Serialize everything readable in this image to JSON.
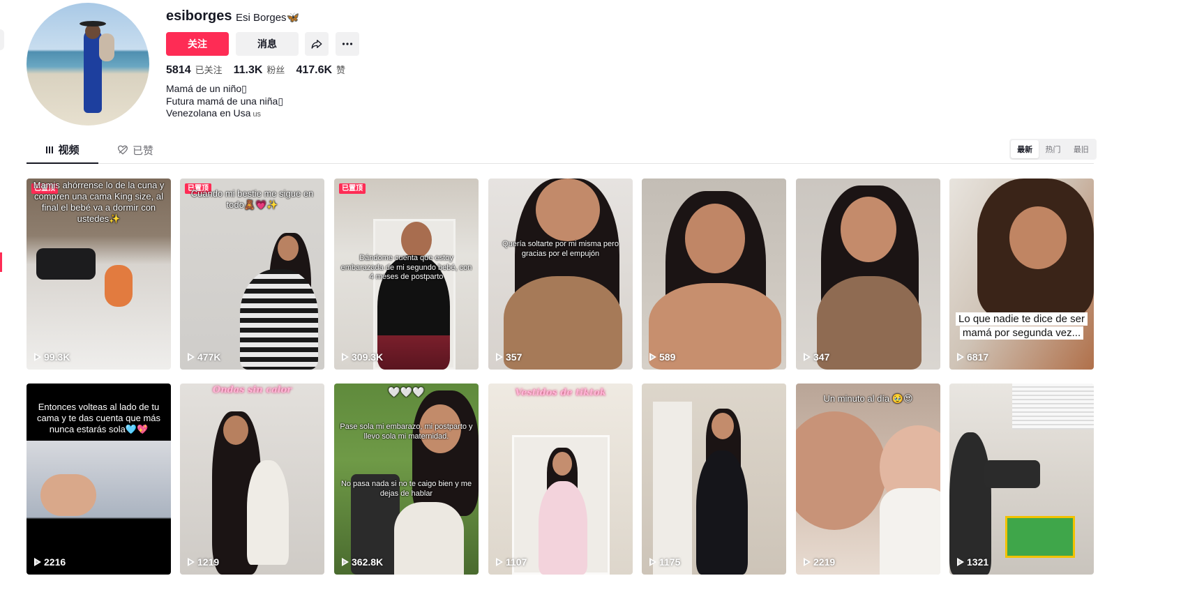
{
  "profile": {
    "username": "esiborges",
    "nickname": "Esi Borges🦋",
    "follow_label": "关注",
    "message_label": "消息",
    "following_count": "5814",
    "following_label": "已关注",
    "followers_count": "11.3K",
    "followers_label": "粉丝",
    "likes_count": "417.6K",
    "likes_label": "赞",
    "bio_line1": "Mamá de un niño▯",
    "bio_line2": "Futura mamá de una niña▯",
    "bio_line3": "Venezolana en Usa",
    "bio_flag": "us"
  },
  "tabs": {
    "videos": "视频",
    "liked": "已赞"
  },
  "sort": {
    "latest": "最新",
    "popular": "热门",
    "oldest": "最旧"
  },
  "pinned_label": "已置顶",
  "videos": [
    {
      "views": "99.3K",
      "caption": "Mamis ahórrense lo de la cuna y compren una cama King size, al final el bebé va a dormir con ustedes✨",
      "pinned": true
    },
    {
      "views": "477K",
      "caption": "Cuando mi bestie me sigue en todo🧸💗✨",
      "pinned": true
    },
    {
      "views": "309.3K",
      "caption": "Dándome cuenta que estoy embarazada de mi segundo bebé, con 4 meses de postparto",
      "pinned": true
    },
    {
      "views": "357",
      "caption": "Quería soltarte por mi misma pero gracias por el empujón",
      "pinned": false
    },
    {
      "views": "589",
      "caption": "",
      "pinned": false
    },
    {
      "views": "347",
      "caption": "",
      "pinned": false
    },
    {
      "views": "6817",
      "caption": "Lo que nadie te dice de ser mamá por segunda vez...",
      "pinned": false
    },
    {
      "views": "2216",
      "caption": "Entonces volteas al lado de tu cama y te das cuenta que más nunca estarás sola🩵💖",
      "pinned": false
    },
    {
      "views": "1219",
      "caption": "Ondas sin calor",
      "pinned": false
    },
    {
      "views": "362.8K",
      "caption": "🤍🤍🤍",
      "caption2": "Pase sola mi embarazo, mi postparto y llevo sola mi maternidad.",
      "caption3": "No pasa nada si no te caigo bien y me dejas de hablar",
      "pinned": false
    },
    {
      "views": "1107",
      "caption": "Vestidos de tiktok",
      "pinned": false
    },
    {
      "views": "1175",
      "caption": "",
      "pinned": false
    },
    {
      "views": "2219",
      "caption": "Un minuto al día 🥹😍",
      "pinned": false
    },
    {
      "views": "1321",
      "caption": "",
      "pinned": false
    }
  ],
  "icons": {
    "share": "share-arrow-icon",
    "more": "ellipsis-icon",
    "videos_tab": "grid-icon",
    "liked_tab": "heart-outline-icon",
    "play": "play-icon"
  },
  "colors": {
    "accent": "#fe2c55",
    "button_gray": "#f1f1f2",
    "text": "#161823"
  }
}
